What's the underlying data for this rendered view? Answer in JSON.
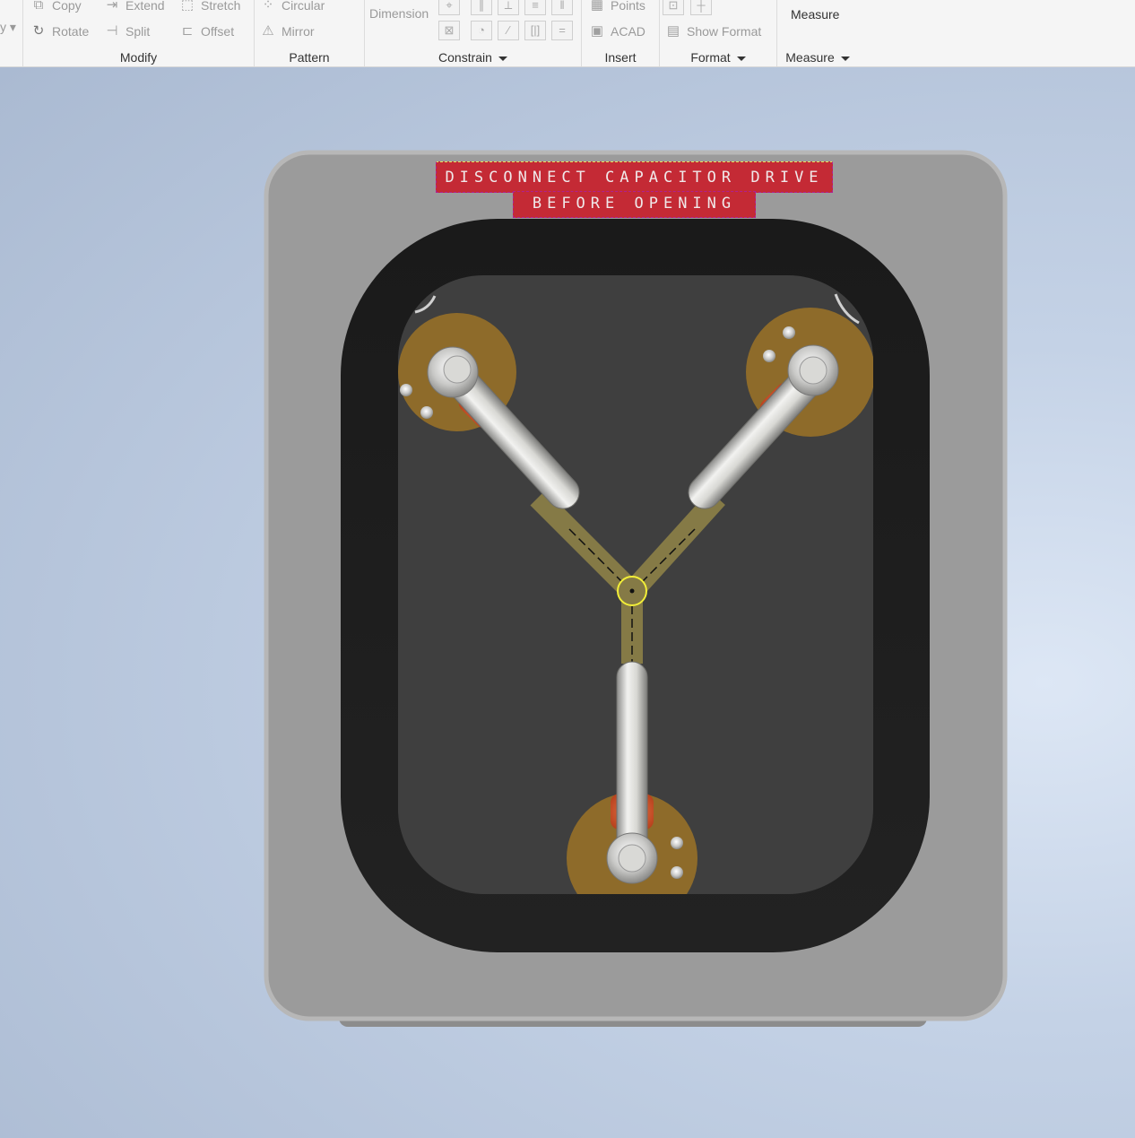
{
  "ribbon": {
    "modify": {
      "name": "Modify",
      "copy": "Copy",
      "extend": "Extend",
      "stretch": "Stretch",
      "rotate": "Rotate",
      "split": "Split",
      "offset": "Offset"
    },
    "pattern": {
      "name": "Pattern",
      "circular": "Circular",
      "mirror": "Mirror"
    },
    "constrain": {
      "name": "Constrain",
      "dimension": "Dimension"
    },
    "insert": {
      "name": "Insert",
      "points": "Points",
      "acad": "ACAD"
    },
    "format": {
      "name": "Format",
      "show_format": "Show Format"
    },
    "measure": {
      "name": "Measure",
      "measure_button": "Measure"
    }
  },
  "model": {
    "label_line1": "DISCONNECT CAPACITOR DRIVE",
    "label_line2": "BEFORE OPENING"
  },
  "colors": {
    "casing": "#9b9b9b",
    "gasket": "#1e1e1e",
    "panel": "#3f3f3f",
    "mount": "#8e6b2a",
    "warning_label": "#c42a35"
  }
}
